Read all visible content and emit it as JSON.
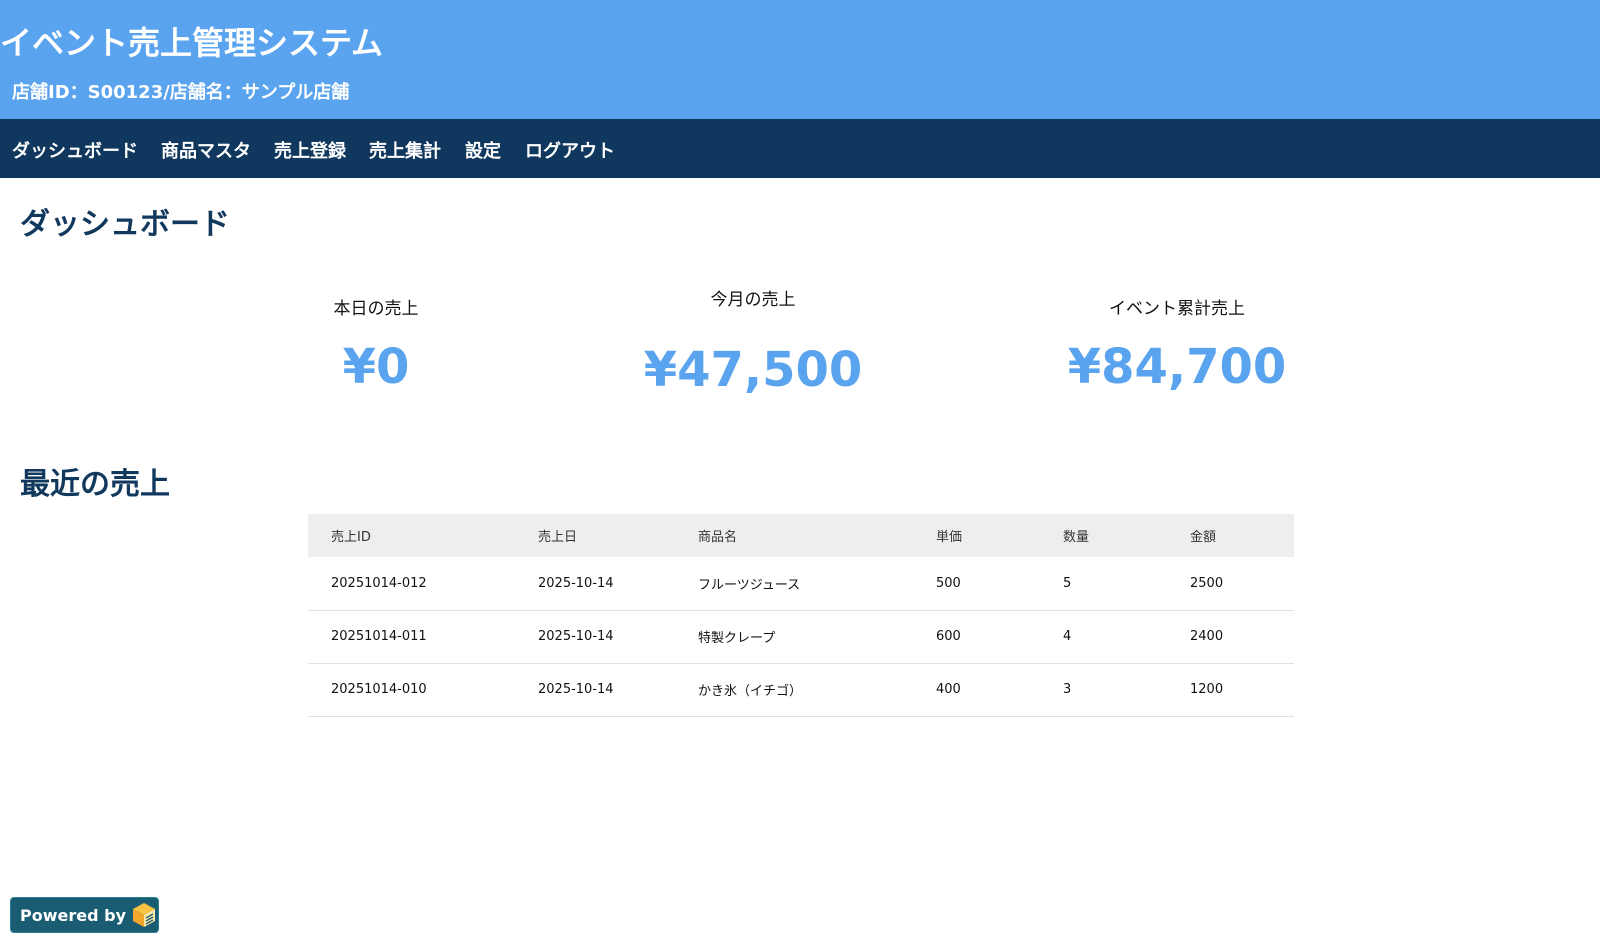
{
  "header": {
    "title": "イベント売上管理システム",
    "store_info": "店舗ID：S00123/店舗名：サンプル店舗"
  },
  "nav": {
    "items": [
      "ダッシュボード",
      "商品マスタ",
      "売上登録",
      "売上集計",
      "設定",
      "ログアウト"
    ]
  },
  "dashboard": {
    "title": "ダッシュボード",
    "kpis": [
      {
        "label": "本日の売上",
        "value": "¥0"
      },
      {
        "label": "今月の売上",
        "value": "¥47,500"
      },
      {
        "label": "イベント累計売上",
        "value": "¥84,700"
      }
    ]
  },
  "recent": {
    "title": "最近の売上",
    "columns": [
      "売上ID",
      "売上日",
      "商品名",
      "単価",
      "数量",
      "金額"
    ],
    "rows": [
      [
        "20251014-012",
        "2025-10-14",
        "フルーツジュース",
        "500",
        "5",
        "2500"
      ],
      [
        "20251014-011",
        "2025-10-14",
        "特製クレープ",
        "600",
        "4",
        "2400"
      ],
      [
        "20251014-010",
        "2025-10-14",
        "かき氷（イチゴ）",
        "400",
        "3",
        "1200"
      ]
    ]
  },
  "footer": {
    "powered_by": "Powered by",
    "logo_icon": "cube-logo-icon"
  },
  "colors": {
    "header_bg": "#5aa3ef",
    "nav_bg": "#10385e",
    "accent": "#5aa3ef",
    "heading": "#11385d"
  }
}
